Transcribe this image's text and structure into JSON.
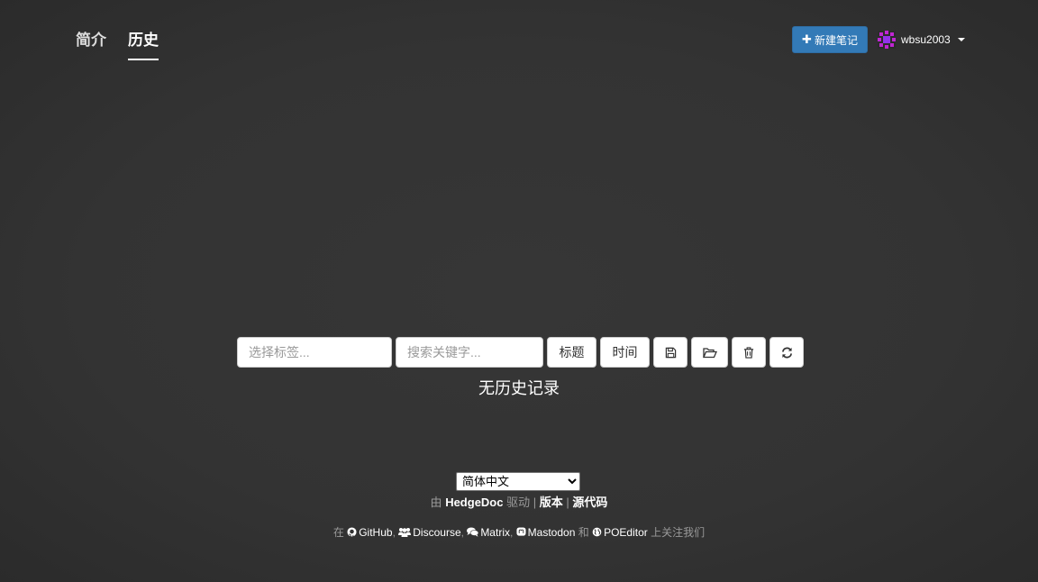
{
  "nav": {
    "tabs": [
      {
        "label": "简介",
        "active": false
      },
      {
        "label": "历史",
        "active": true
      }
    ],
    "new_note_label": "新建笔记",
    "username": "wbsu2003"
  },
  "toolbar": {
    "tags_placeholder": "选择标签...",
    "search_placeholder": "搜索关键字...",
    "sort_title_label": "标题",
    "sort_time_label": "时间",
    "icons": [
      "save-icon",
      "folder-open-icon",
      "trash-icon",
      "refresh-icon"
    ]
  },
  "history": {
    "empty_message": "无历史记录"
  },
  "footer": {
    "language": "简体中文",
    "powered_prefix": "由",
    "powered_name": "HedgeDoc",
    "powered_suffix": "驱动",
    "sep": "|",
    "version_label": "版本",
    "source_label": "源代码",
    "social_prefix": "在",
    "social_links": [
      "GitHub",
      "Discourse",
      "Matrix",
      "Mastodon",
      "POEditor"
    ],
    "comma": ",",
    "and": "和",
    "social_suffix": "上关注我们"
  },
  "colors": {
    "background": "#333333",
    "primary_button": "#337ab7",
    "avatar_accent": "#c026d3"
  }
}
